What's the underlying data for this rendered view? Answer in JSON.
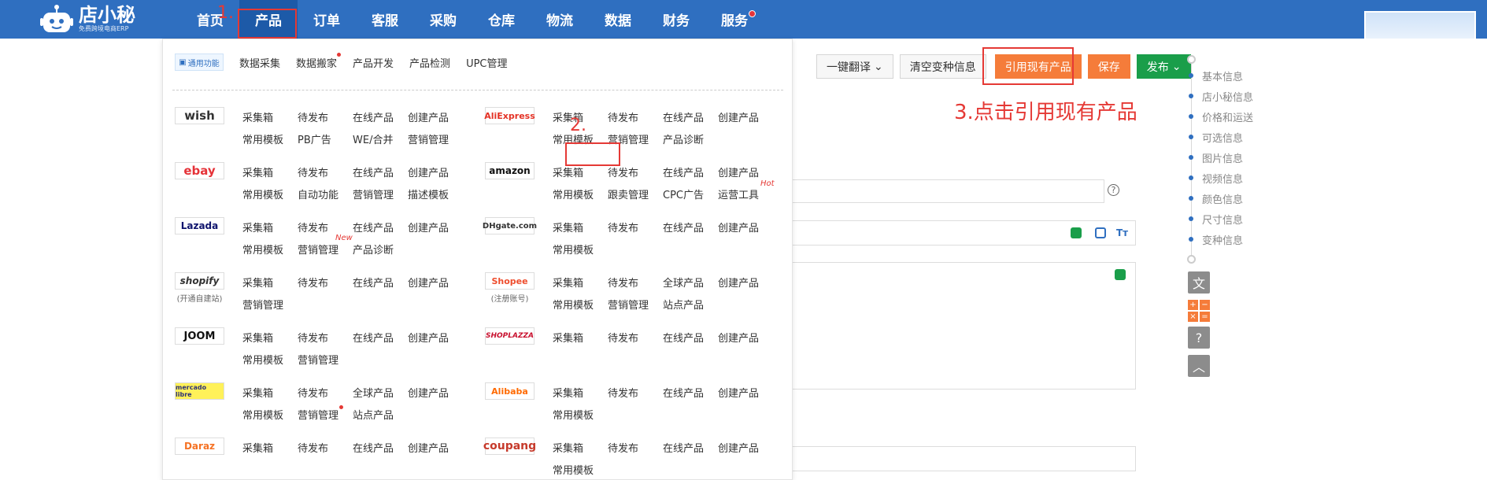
{
  "brand": {
    "name": "店小秘",
    "sub": "免费跨境电商ERP"
  },
  "nav": [
    "首页",
    "产品",
    "订单",
    "客服",
    "采购",
    "仓库",
    "物流",
    "数据",
    "财务",
    "服务"
  ],
  "annotations": {
    "step1": "1.",
    "step2": "2.",
    "step3": "3.点击引用现有产品"
  },
  "toolbar": {
    "translate": "一键翻译",
    "clear": "清空变种信息",
    "quote": "引用现有产品",
    "save": "保存",
    "publish": "发布"
  },
  "right_nav": [
    "基本信息",
    "店小秘信息",
    "价格和运送",
    "可选信息",
    "图片信息",
    "视频信息",
    "颜色信息",
    "尺寸信息",
    "变种信息"
  ],
  "calc": [
    "+",
    "−",
    "×",
    "="
  ],
  "common": {
    "badge": "通用功能",
    "links": [
      "数据采集",
      "数据搬家",
      "产品开发",
      "产品检测",
      "UPC管理"
    ]
  },
  "platforms": {
    "wish": {
      "logo": "wish",
      "row1": [
        "采集箱",
        "待发布",
        "在线产品",
        "创建产品"
      ],
      "row2": [
        "常用模板",
        "PB广告",
        "WE/合并",
        "营销管理"
      ]
    },
    "aliexpress": {
      "logo": "AliExpress",
      "row1": [
        "采集箱",
        "待发布",
        "在线产品",
        "创建产品"
      ],
      "row2": [
        "常用模板",
        "营销管理",
        "产品诊断"
      ]
    },
    "ebay": {
      "logo": "ebay",
      "row1": [
        "采集箱",
        "待发布",
        "在线产品",
        "创建产品"
      ],
      "row2": [
        "常用模板",
        "自动功能",
        "营销管理",
        "描述模板"
      ]
    },
    "amazon": {
      "logo": "amazon",
      "row1": [
        "采集箱",
        "待发布",
        "在线产品",
        "创建产品"
      ],
      "row2": [
        "常用模板",
        "跟卖管理",
        "CPC广告",
        "运营工具"
      ],
      "tag": "Hot"
    },
    "lazada": {
      "logo": "Lazada",
      "row1": [
        "采集箱",
        "待发布",
        "在线产品",
        "创建产品"
      ],
      "row2": [
        "常用模板",
        "营销管理",
        "产品诊断"
      ],
      "tag": "New"
    },
    "dhgate": {
      "logo": "DHgate.com",
      "row1": [
        "采集箱",
        "待发布",
        "在线产品",
        "创建产品"
      ],
      "row2": [
        "常用模板"
      ]
    },
    "shopify": {
      "logo": "shopify",
      "sub": "(开通自建站)",
      "row1": [
        "采集箱",
        "待发布",
        "在线产品",
        "创建产品"
      ],
      "row2": [
        "营销管理"
      ]
    },
    "shopee": {
      "logo": "Shopee",
      "sub": "(注册账号)",
      "row1": [
        "采集箱",
        "待发布",
        "全球产品",
        "创建产品"
      ],
      "row2": [
        "常用模板",
        "营销管理",
        "站点产品"
      ]
    },
    "joom": {
      "logo": "JOOM",
      "row1": [
        "采集箱",
        "待发布",
        "在线产品",
        "创建产品"
      ],
      "row2": [
        "常用模板",
        "营销管理"
      ]
    },
    "shoplazza": {
      "logo": "SHOPLAZZA",
      "row1": [
        "采集箱",
        "待发布",
        "在线产品",
        "创建产品"
      ]
    },
    "mercado": {
      "logo": "mercado libre",
      "row1": [
        "采集箱",
        "待发布",
        "全球产品",
        "创建产品"
      ],
      "row2": [
        "常用模板",
        "营销管理",
        "站点产品"
      ]
    },
    "alibaba": {
      "logo": "Alibaba",
      "row1": [
        "采集箱",
        "待发布",
        "在线产品",
        "创建产品"
      ],
      "row2": [
        "常用模板"
      ]
    },
    "daraz": {
      "logo": "Daraz",
      "row1": [
        "采集箱",
        "待发布",
        "在线产品",
        "创建产品"
      ]
    },
    "coupang": {
      "logo": "coupang",
      "row1": [
        "采集箱",
        "待发布",
        "在线产品",
        "创建产品"
      ],
      "row2": [
        "常用模板"
      ]
    }
  },
  "colors": {
    "topbar": "#2f6fc0",
    "accent": "#f57c3a",
    "green": "#1a9e4a",
    "annotation": "#e53935"
  }
}
